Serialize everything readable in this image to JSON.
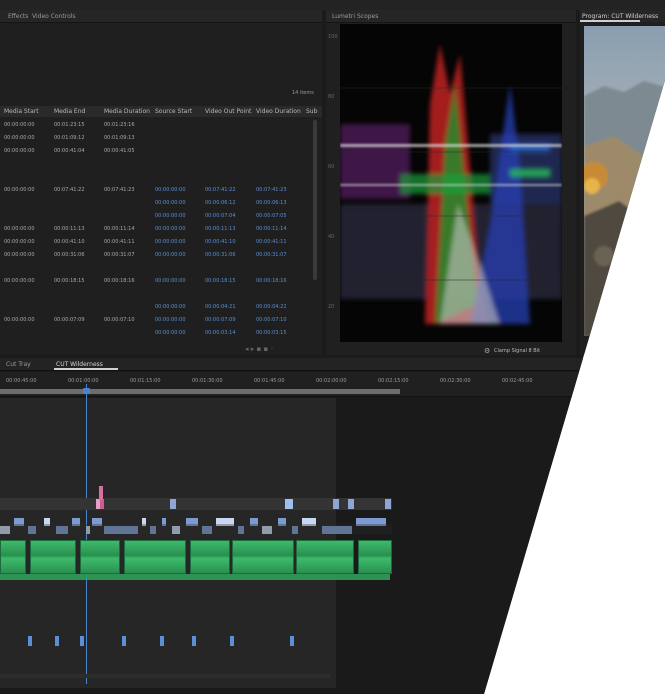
{
  "project": {
    "tabs": [
      "Effects",
      "Video Controls"
    ],
    "item_count": "14 items",
    "columns": [
      "Media Start",
      "Media End",
      "Media Duration",
      "Source Start",
      "Video Out Point",
      "Video Duration",
      "Sub"
    ],
    "rows": [
      {
        "cells": [
          "00:00:00:00",
          "00:01:23:15",
          "00:01:23:16",
          "",
          "",
          "",
          ""
        ]
      },
      {
        "cells": [
          "00:00:00:00",
          "00:01:09:12",
          "00:01:09:13",
          "",
          "",
          "",
          ""
        ]
      },
      {
        "cells": [
          "00:00:00:00",
          "00:00:41:04",
          "00:00:41:05",
          "",
          "",
          "",
          ""
        ]
      },
      {
        "cells": [
          "",
          "",
          "",
          "",
          "",
          "",
          ""
        ]
      },
      {
        "cells": [
          "",
          "",
          "",
          "",
          "",
          "",
          ""
        ]
      },
      {
        "cells": [
          "00:00:00:00",
          "00:07:41:22",
          "00:07:41:23",
          "00:00:00:00",
          "00:07:41:22",
          "00:07:41:23",
          ""
        ]
      },
      {
        "cells": [
          "",
          "",
          "",
          "00:00:00:00",
          "00:00:06:12",
          "00:00:06:13",
          ""
        ]
      },
      {
        "cells": [
          "",
          "",
          "",
          "00:00:00:00",
          "00:00:07:04",
          "00:00:07:05",
          ""
        ]
      },
      {
        "cells": [
          "00:00:00:00",
          "00:00:11:13",
          "00:00:11:14",
          "00:00:00:00",
          "00:00:11:13",
          "00:00:11:14",
          ""
        ]
      },
      {
        "cells": [
          "00:00:00:00",
          "00:00:41:10",
          "00:00:41:11",
          "00:00:00:00",
          "00:00:41:10",
          "00:00:41:11",
          ""
        ]
      },
      {
        "cells": [
          "00:00:00:00",
          "00:00:31:06",
          "00:00:31:07",
          "00:00:00:00",
          "00:00:31:06",
          "00:00:31:07",
          ""
        ]
      },
      {
        "cells": [
          "",
          "",
          "",
          "",
          "",
          "",
          ""
        ]
      },
      {
        "cells": [
          "00:00:00:00",
          "00:00:18:15",
          "00:00:18:16",
          "00:00:00:00",
          "00:00:18:15",
          "00:00:18:16",
          ""
        ]
      },
      {
        "cells": [
          "",
          "",
          "",
          "",
          "",
          "",
          ""
        ]
      },
      {
        "cells": [
          "",
          "",
          "",
          "00:00:00:00",
          "00:00:04:21",
          "00:00:04:22",
          ""
        ]
      },
      {
        "cells": [
          "00:00:00:00",
          "00:00:07:09",
          "00:00:07:10",
          "00:00:00:00",
          "00:00:07:09",
          "00:00:07:10",
          ""
        ]
      },
      {
        "cells": [
          "",
          "",
          "",
          "00:00:00:00",
          "00:00:03:14",
          "00:00:03:15",
          ""
        ]
      }
    ]
  },
  "scopes": {
    "tab": "Lumetri Scopes",
    "scale": [
      "100",
      "80",
      "60",
      "40",
      "20"
    ],
    "footer": "Clamp Signal  8 Bit"
  },
  "program": {
    "tab": "Program: CUT Wilderness"
  },
  "timeline": {
    "tabs": [
      "Cut Tray",
      "CUT Wilderness"
    ],
    "ruler": [
      "00:00:45:00",
      "00:01:00:00",
      "00:01:15:00",
      "00:01:30:00",
      "00:01:45:00",
      "00:02:00:00",
      "00:02:15:00",
      "00:02:30:00",
      "00:02:45:00"
    ]
  },
  "colors": {
    "background": "#1b1b1b",
    "accent": "#4a84d0",
    "video_clip": "#8ea6d6",
    "audio_clip": "#2f9e5a"
  }
}
